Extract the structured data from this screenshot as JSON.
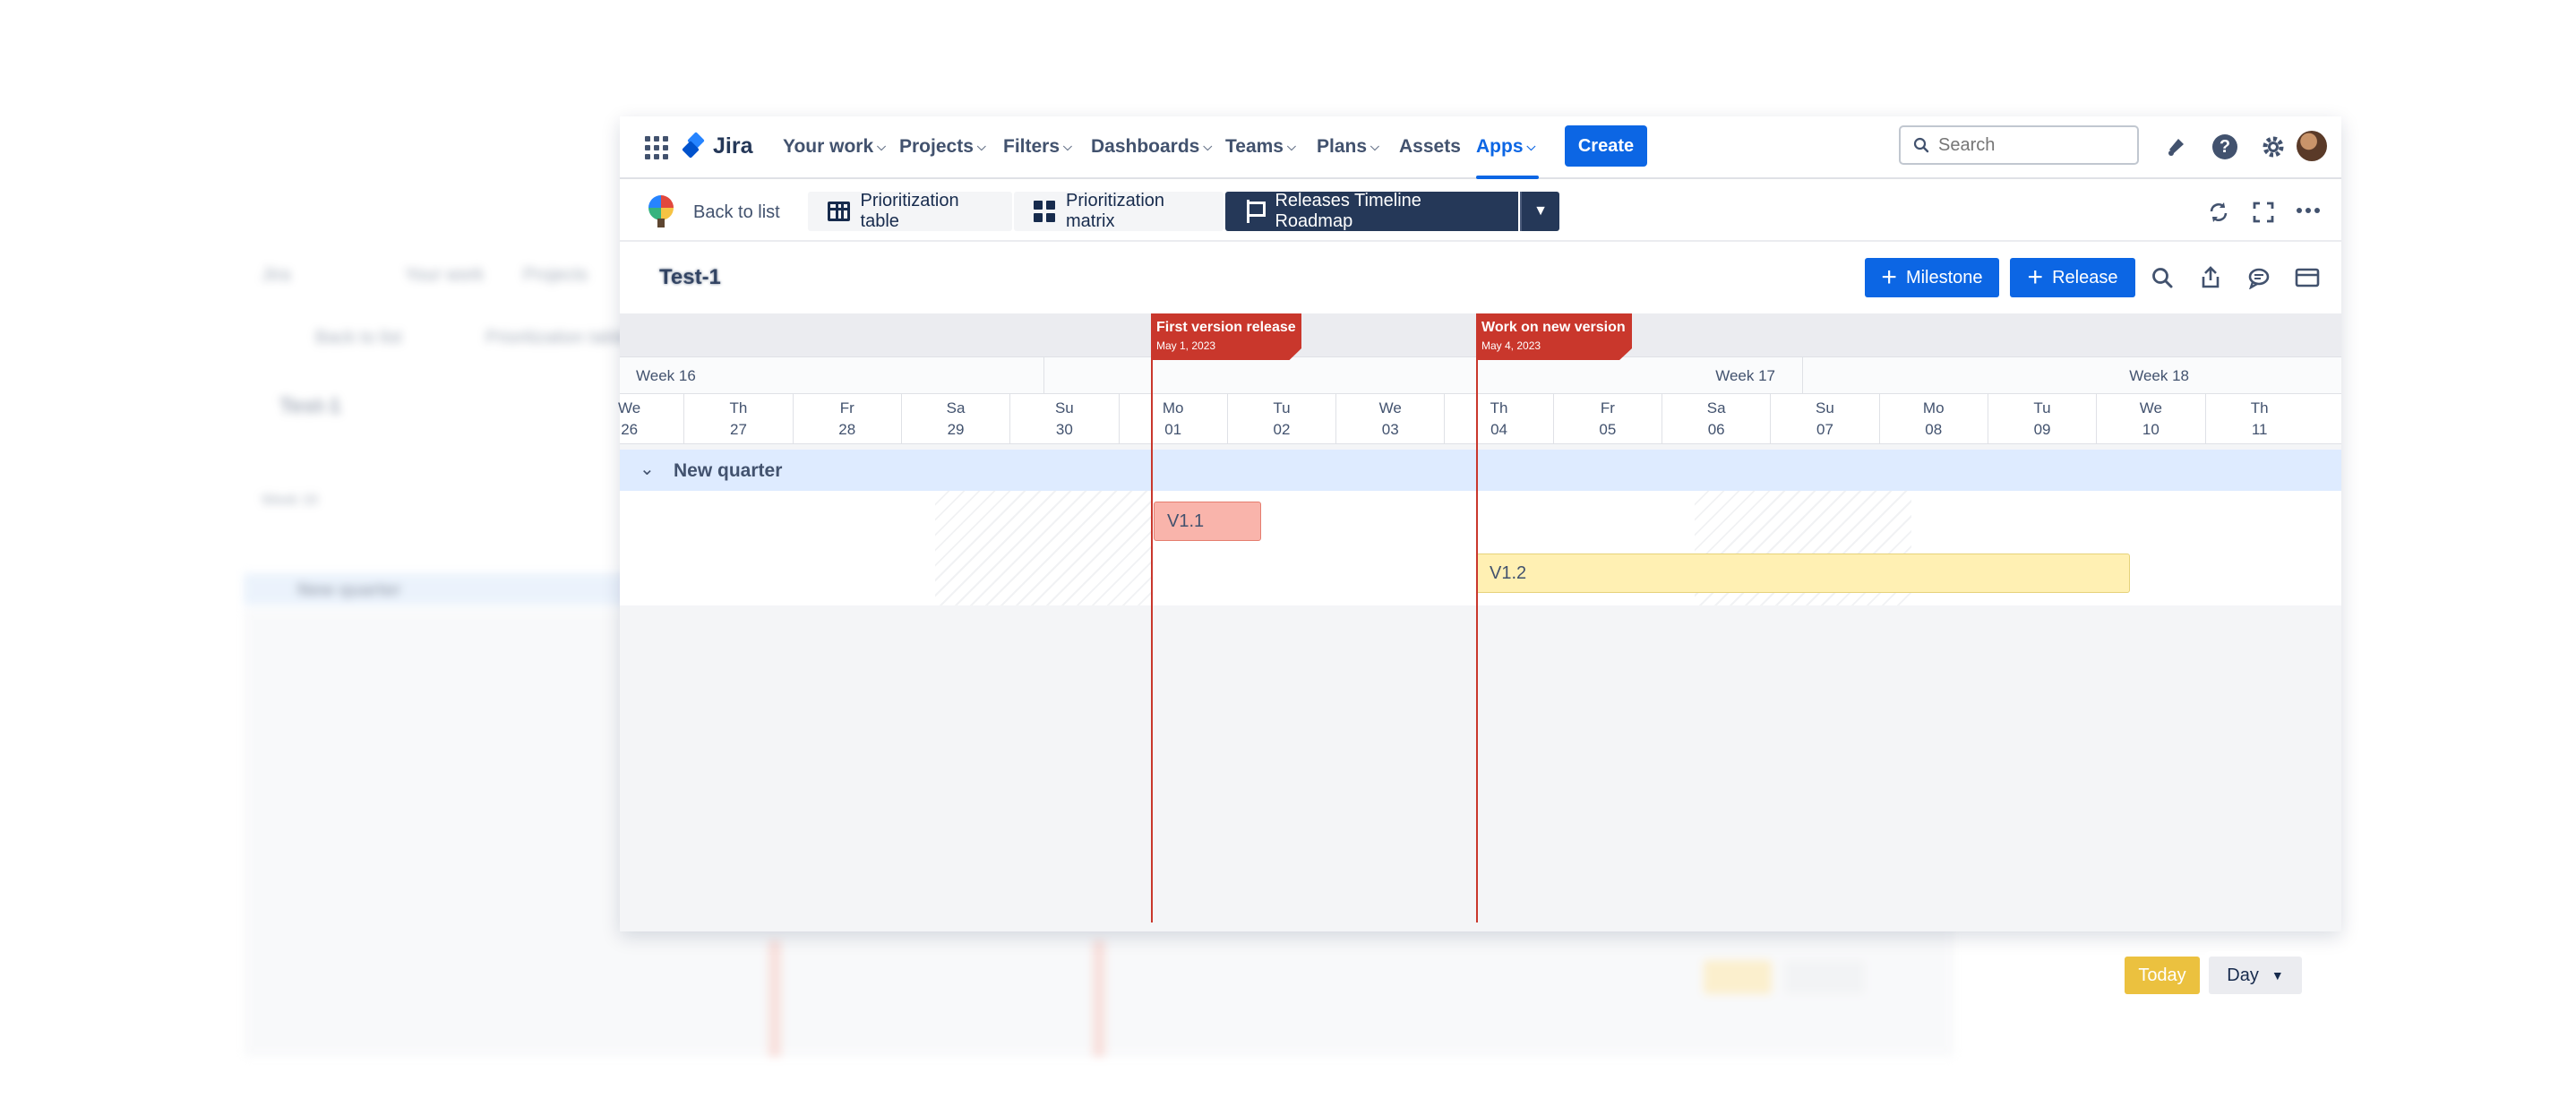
{
  "ghost": {
    "nav": [
      "Jira",
      "Your work",
      "Projects"
    ],
    "back": "Back to list",
    "tab": "Prioritization table",
    "title": "Test-1",
    "week": "Week 16",
    "group": "New quarter",
    "today": "Today",
    "day": "Day"
  },
  "nav": {
    "logo_text": "Jira",
    "items": [
      {
        "label": "Your work"
      },
      {
        "label": "Projects"
      },
      {
        "label": "Filters"
      },
      {
        "label": "Dashboards"
      },
      {
        "label": "Teams"
      },
      {
        "label": "Plans"
      },
      {
        "label": "Assets"
      },
      {
        "label": "Apps"
      }
    ],
    "create_label": "Create",
    "search_placeholder": "Search"
  },
  "app_toolbar": {
    "back_label": "Back to list",
    "tabs": [
      {
        "label": "Prioritization table",
        "icon": "table-icon"
      },
      {
        "label": "Prioritization matrix",
        "icon": "matrix-icon"
      },
      {
        "label": "Releases Timeline Roadmap",
        "icon": "flag-icon",
        "active": true
      }
    ]
  },
  "board": {
    "title": "Test-1",
    "milestone_button": "Milestone",
    "release_button": "Release"
  },
  "timeline": {
    "weeks": [
      "Week 16",
      "Week 17",
      "Week 18"
    ],
    "days": [
      {
        "dow": "We",
        "num": "26"
      },
      {
        "dow": "Th",
        "num": "27"
      },
      {
        "dow": "Fr",
        "num": "28"
      },
      {
        "dow": "Sa",
        "num": "29"
      },
      {
        "dow": "Su",
        "num": "30"
      },
      {
        "dow": "Mo",
        "num": "01"
      },
      {
        "dow": "Tu",
        "num": "02"
      },
      {
        "dow": "We",
        "num": "03"
      },
      {
        "dow": "Th",
        "num": "04"
      },
      {
        "dow": "Fr",
        "num": "05"
      },
      {
        "dow": "Sa",
        "num": "06"
      },
      {
        "dow": "Su",
        "num": "07"
      },
      {
        "dow": "Mo",
        "num": "08"
      },
      {
        "dow": "Tu",
        "num": "09"
      },
      {
        "dow": "We",
        "num": "10"
      },
      {
        "dow": "Th",
        "num": "11"
      }
    ],
    "group_label": "New quarter",
    "milestones": [
      {
        "title": "First version release",
        "date": "May 1, 2023"
      },
      {
        "title": "Work on new version",
        "date": "May 4, 2023"
      }
    ],
    "releases": [
      {
        "name": "V1.1",
        "start": "May 1, 2023",
        "end": "May 1, 2023",
        "color": "#f9b4ab"
      },
      {
        "name": "V1.2",
        "start": "May 4, 2023",
        "end": "May 9, 2023",
        "color": "#fff0b3"
      }
    ],
    "today_label": "Today",
    "scale_label": "Day"
  },
  "colors": {
    "primary": "#0c66e4",
    "milestone": "#c9372c",
    "group_band": "#deebff",
    "toolbar_active": "#253858",
    "today_button": "#ebc13f"
  }
}
